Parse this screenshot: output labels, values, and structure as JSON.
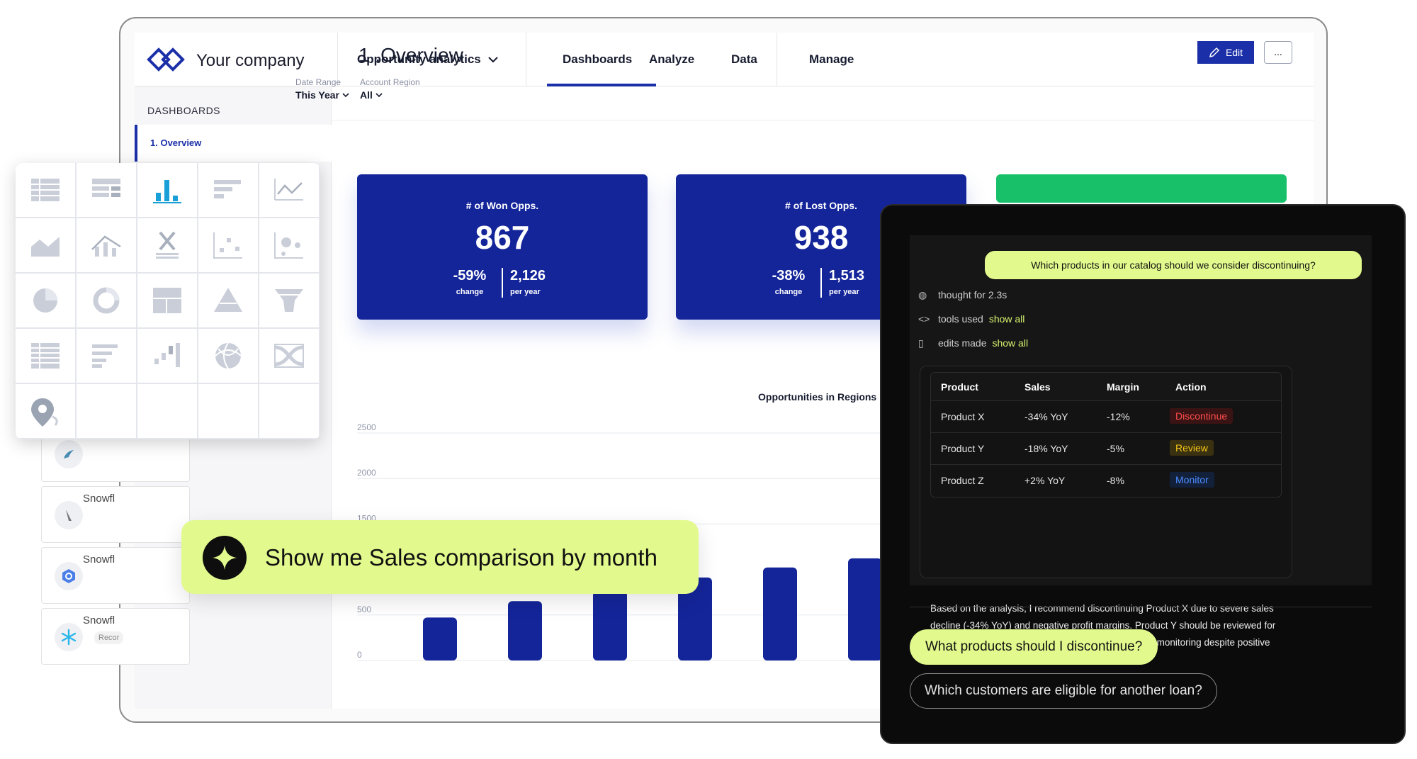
{
  "header": {
    "company": "Your company",
    "nav_dropdown": "Opportunity analytics",
    "tabs": [
      {
        "label": "Dashboards",
        "active": true
      },
      {
        "label": "Analyze"
      },
      {
        "label": "Data"
      },
      {
        "label": "Manage"
      }
    ]
  },
  "sidebar": {
    "heading": "DASHBOARDS",
    "active_item": "1. Overview",
    "cards": [
      {
        "name": "Snowfl",
        "icon": "pen-icon"
      },
      {
        "name": "Snowfl",
        "icon": "google-icon"
      },
      {
        "name": "Snowfl",
        "icon": "snowflake-icon",
        "tag": "Recor"
      }
    ]
  },
  "main": {
    "title": "1 .Overview",
    "edit_label": "Edit",
    "more_label": "...",
    "filters": [
      {
        "label": "Date Range",
        "value": "This Year"
      },
      {
        "label": "Account Region",
        "value": "All"
      }
    ],
    "kpis": [
      {
        "title": "# of Won Opps.",
        "value": "867",
        "change": "-59%",
        "change_label": "change",
        "per_year": "2,126",
        "per_year_label": "per year"
      },
      {
        "title": "# of Lost Opps.",
        "value": "938",
        "change": "-38%",
        "change_label": "change",
        "per_year": "1,513",
        "per_year_label": "per year"
      }
    ]
  },
  "chart_data": {
    "type": "bar",
    "title": "Opportunities in Regions",
    "yticks": [
      "2500",
      "2000",
      "1500",
      "500",
      "0"
    ],
    "ylim": [
      0,
      2500
    ],
    "values": [
      410,
      590,
      700,
      850,
      960,
      1060
    ],
    "color": "#14259a"
  },
  "palette": {
    "icons": [
      "table-icon",
      "pivot-table-icon",
      "bar-chart-icon",
      "horizontal-bar-icon",
      "line-chart-icon",
      "area-chart-icon",
      "line-bar-combo-icon",
      "kpi-x-icon",
      "scatter-icon",
      "bubble-icon",
      "pie-chart-icon",
      "donut-chart-icon",
      "treemap-icon",
      "pyramid-icon",
      "funnel-icon",
      "pivot-grid-icon",
      "gantt-icon",
      "waterfall-icon",
      "sphere-icon",
      "sankey-icon",
      "map-pin-icon"
    ]
  },
  "prompt": {
    "text": "Show me Sales comparison by month"
  },
  "ai": {
    "question": "Which products in our catalog should we consider discontinuing?",
    "thought": "thought for 2.3s",
    "tools_label": "tools used",
    "edits_label": "edits made",
    "show_all": "show all",
    "table": {
      "columns": [
        "Product",
        "Sales",
        "Margin",
        "Action"
      ],
      "rows": [
        {
          "product": "Product X",
          "sales": "-34% YoY",
          "margin": "-12%",
          "action": "Discontinue",
          "action_color": "#ff4d4d",
          "action_bg": "#3a1414"
        },
        {
          "product": "Product Y",
          "sales": "-18% YoY",
          "margin": "-5%",
          "action": "Review",
          "action_color": "#f5c518",
          "action_bg": "#3a3110"
        },
        {
          "product": "Product Z",
          "sales": "+2% YoY",
          "margin": "-8%",
          "action": "Monitor",
          "action_color": "#4d8dff",
          "action_bg": "#12203a"
        }
      ]
    },
    "summary": "Based on the analysis, I recommend discontinuing Product X due to severe sales decline (-34% YoY) and negative profit margins. Product Y should be reviewed for potential improvements, while Product Z needs close monitoring despite positive sales growth.",
    "suggestions": [
      "What products should I discontinue?",
      "Which customers are eligible for another loan?"
    ]
  }
}
